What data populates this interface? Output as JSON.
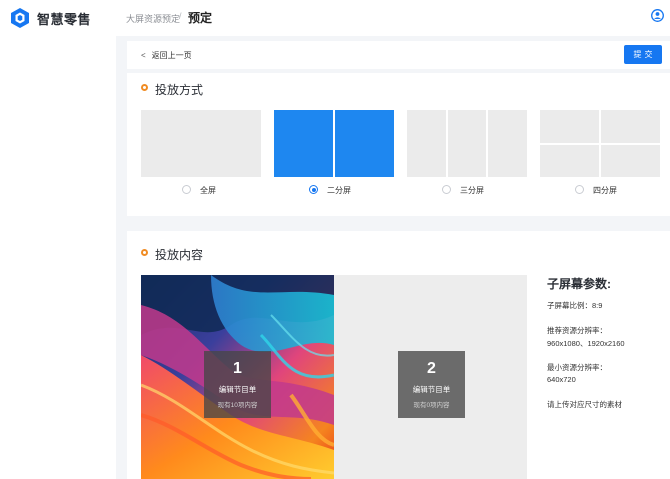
{
  "app": {
    "name": "智慧零售"
  },
  "breadcrumb": {
    "parent": "大屏资源预定",
    "separator": "/",
    "current": "预定"
  },
  "toolbar": {
    "back_arrow": "<",
    "back_label": "返回上一页",
    "submit_label": "提交"
  },
  "layout_section": {
    "title": "投放方式",
    "options": [
      {
        "label": "全屏",
        "selected": false
      },
      {
        "label": "二分屏",
        "selected": true
      },
      {
        "label": "三分屏",
        "selected": false
      },
      {
        "label": "四分屏",
        "selected": false
      }
    ]
  },
  "content_section": {
    "title": "投放内容",
    "slots": [
      {
        "number": "1",
        "name": "编辑节目单",
        "count": "现有10项内容"
      },
      {
        "number": "2",
        "name": "编辑节目单",
        "count": "现有0项内容"
      }
    ]
  },
  "params": {
    "title": "子屏幕参数:",
    "ratio": "子屏幕比例：8:9",
    "recommended_label": "推荐资源分辨率：",
    "recommended_value": "960x1080、1920x2160",
    "min_label": "最小资源分辨率：",
    "min_value": "640x720",
    "note": "请上传对应尺寸的素材"
  },
  "colors": {
    "accent": "#1677f1",
    "selected_layout": "#1e87f0",
    "unselected_layout": "#ebebeb",
    "section_dot": "#f08c24"
  },
  "icons": {
    "logo": "hexagon-logo-icon",
    "user": "user-icon",
    "back": "chevron-left-icon"
  }
}
